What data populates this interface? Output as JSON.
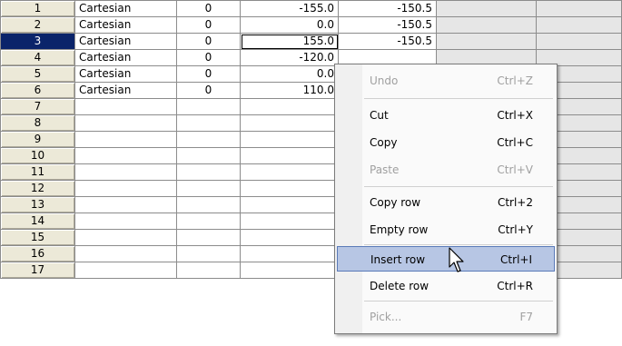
{
  "rows": [
    {
      "n": "1",
      "type": "Cartesian",
      "flag": "0",
      "a": "-155.0",
      "b": "-150.5"
    },
    {
      "n": "2",
      "type": "Cartesian",
      "flag": "0",
      "a": "0.0",
      "b": "-150.5"
    },
    {
      "n": "3",
      "type": "Cartesian",
      "flag": "0",
      "a": "155.0",
      "b": "-150.5"
    },
    {
      "n": "4",
      "type": "Cartesian",
      "flag": "0",
      "a": "-120.0",
      "b": ""
    },
    {
      "n": "5",
      "type": "Cartesian",
      "flag": "0",
      "a": "0.0",
      "b": ""
    },
    {
      "n": "6",
      "type": "Cartesian",
      "flag": "0",
      "a": "110.0",
      "b": ""
    },
    {
      "n": "7",
      "type": "",
      "flag": "",
      "a": "",
      "b": ""
    },
    {
      "n": "8",
      "type": "",
      "flag": "",
      "a": "",
      "b": ""
    },
    {
      "n": "9",
      "type": "",
      "flag": "",
      "a": "",
      "b": ""
    },
    {
      "n": "10",
      "type": "",
      "flag": "",
      "a": "",
      "b": ""
    },
    {
      "n": "11",
      "type": "",
      "flag": "",
      "a": "",
      "b": ""
    },
    {
      "n": "12",
      "type": "",
      "flag": "",
      "a": "",
      "b": ""
    },
    {
      "n": "13",
      "type": "",
      "flag": "",
      "a": "",
      "b": ""
    },
    {
      "n": "14",
      "type": "",
      "flag": "",
      "a": "",
      "b": ""
    },
    {
      "n": "15",
      "type": "",
      "flag": "",
      "a": "",
      "b": ""
    },
    {
      "n": "16",
      "type": "",
      "flag": "",
      "a": "",
      "b": ""
    },
    {
      "n": "17",
      "type": "",
      "flag": "",
      "a": "",
      "b": ""
    }
  ],
  "selected_row": "3",
  "menu": [
    {
      "label": "Undo",
      "shortcut": "Ctrl+Z",
      "state": "disabled"
    },
    {
      "label": "Cut",
      "shortcut": "Ctrl+X",
      "state": "enabled"
    },
    {
      "label": "Copy",
      "shortcut": "Ctrl+C",
      "state": "enabled"
    },
    {
      "label": "Paste",
      "shortcut": "Ctrl+V",
      "state": "disabled"
    },
    {
      "label": "Copy row",
      "shortcut": "Ctrl+2",
      "state": "enabled"
    },
    {
      "label": "Empty row",
      "shortcut": "Ctrl+Y",
      "state": "enabled"
    },
    {
      "label": "Insert row",
      "shortcut": "Ctrl+I",
      "state": "hover"
    },
    {
      "label": "Delete row",
      "shortcut": "Ctrl+R",
      "state": "enabled"
    },
    {
      "label": "Pick...",
      "shortcut": "F7",
      "state": "disabled"
    }
  ],
  "colors": {
    "row_header_selected": "#0a246a",
    "menu_highlight": "#b7c6e4",
    "blank_column": "#e6e6e6"
  },
  "icons": {
    "cursor": "arrow-pointer-icon"
  }
}
